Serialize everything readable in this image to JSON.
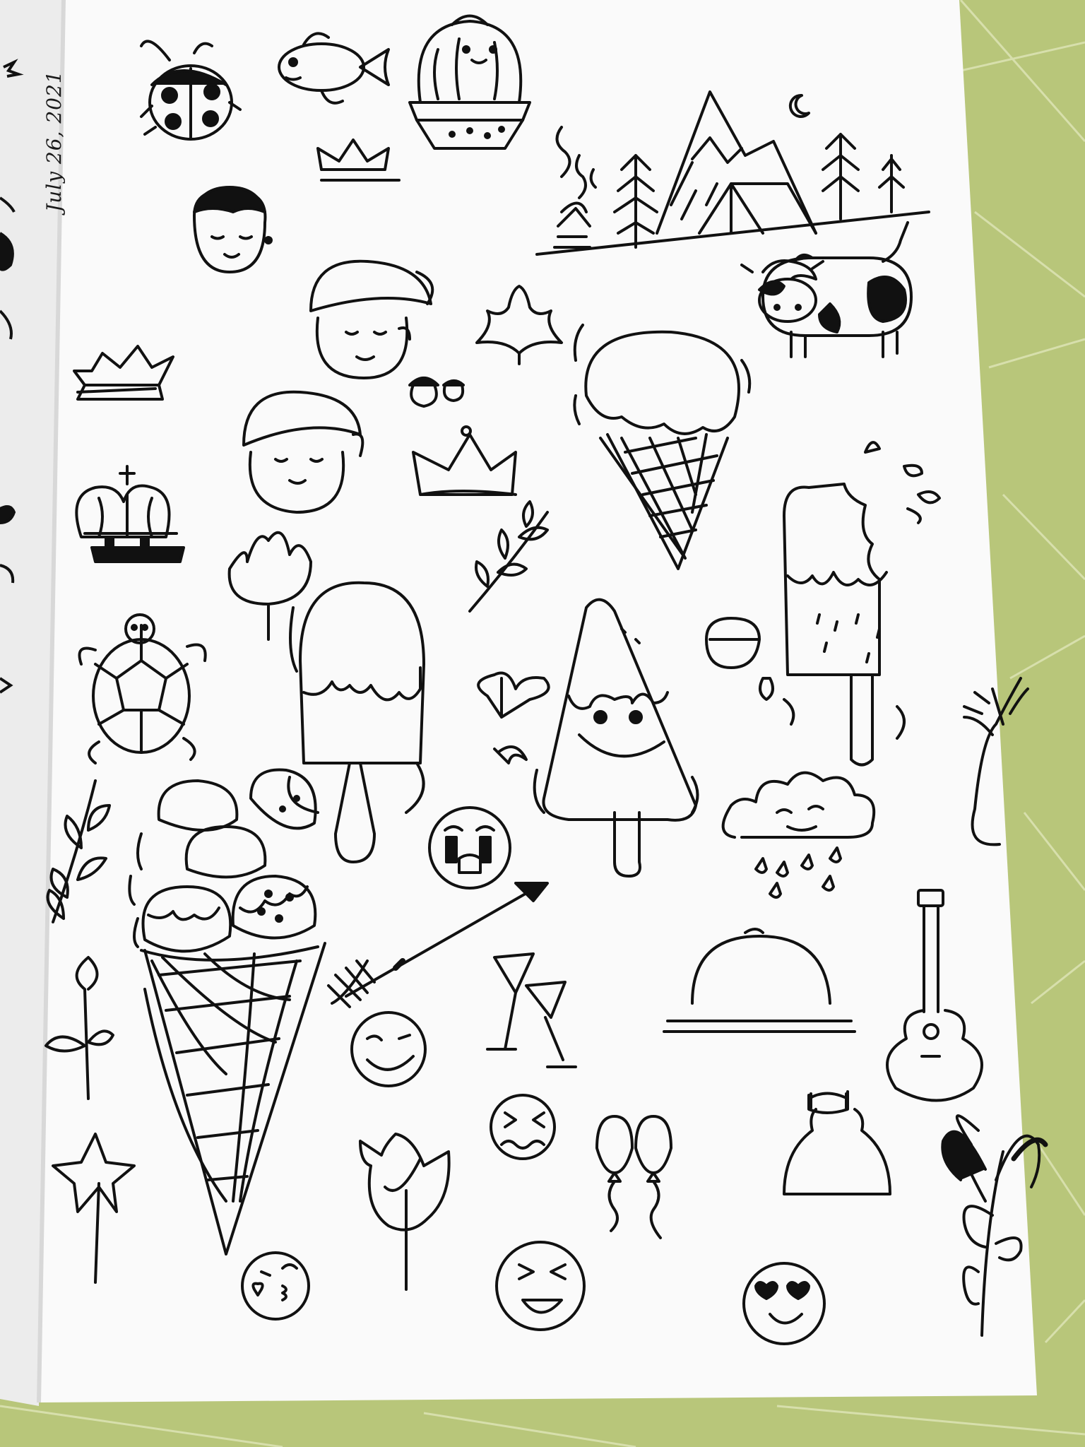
{
  "photo": {
    "date_note": "July 26, 2021",
    "colors": {
      "tablecloth": "#b8c67a",
      "tablecloth_lines": "#dfe6b9",
      "paper": "#fafafa",
      "prev_page": "#ececec",
      "ink": "#111111"
    },
    "doodles": [
      "ladybug",
      "fish",
      "cactus",
      "crown",
      "boy-face",
      "mountain-camp",
      "moon",
      "campfire",
      "pine-tree",
      "tent",
      "cow",
      "girl-with-cap",
      "maple-leaf",
      "acorns",
      "ice-cream-cone",
      "popsicle",
      "popsicle-with-bite",
      "king-crown",
      "turtle",
      "leaf",
      "olive-branch",
      "smiling-popsicle",
      "crying-face",
      "rain-cloud",
      "twig-with-berries",
      "triple-scoop-cone",
      "arrow",
      "cocktail-glasses",
      "food-cloche",
      "guitar",
      "winking-face",
      "dizzy-face",
      "balloons",
      "dress",
      "palm-plant",
      "star-wand",
      "rose",
      "laughing-face",
      "heart-eyes-face",
      "kissing-face"
    ]
  }
}
